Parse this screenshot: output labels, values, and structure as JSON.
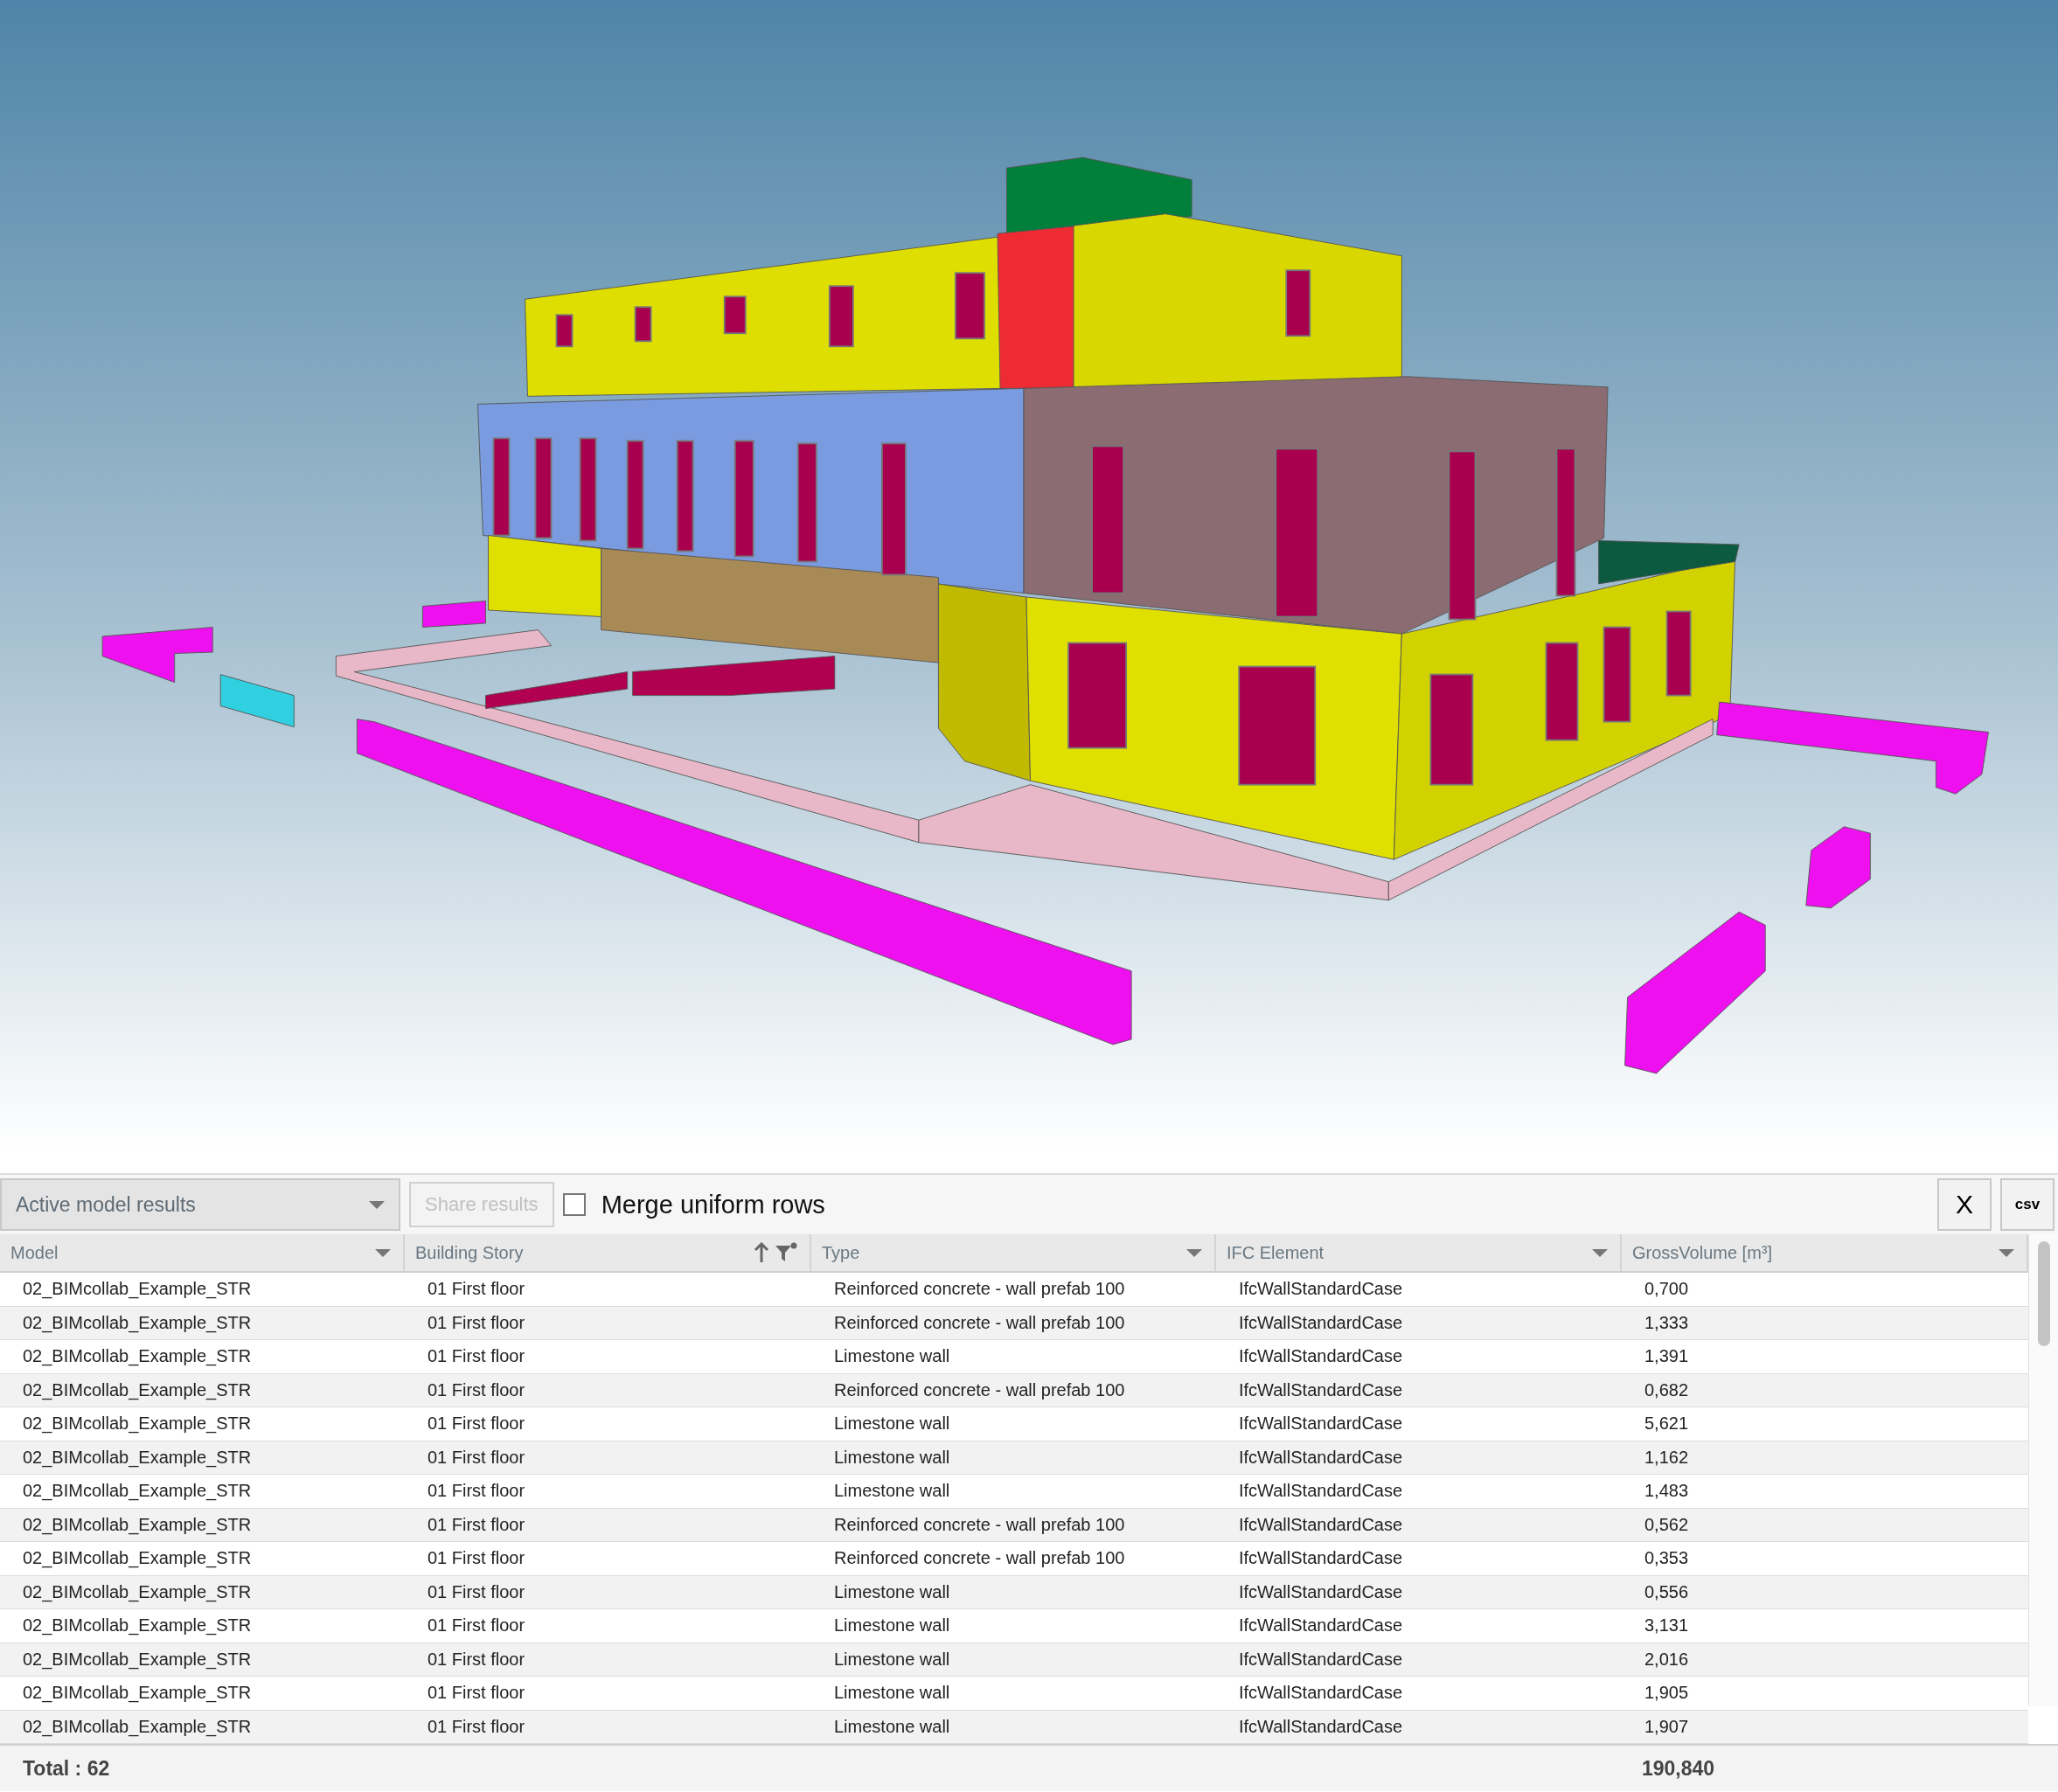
{
  "toolbar": {
    "results_dropdown": {
      "value": "Active model results"
    },
    "share_button": {
      "label": "Share results",
      "disabled": true
    },
    "merge_checkbox": {
      "label": "Merge uniform rows",
      "checked": false
    },
    "close_button": {
      "label": "X"
    },
    "csv_button": {
      "label": "csv"
    }
  },
  "table": {
    "columns": [
      {
        "label": "Model",
        "sorted": false,
        "filtered": false
      },
      {
        "label": "Building Story",
        "sorted": true,
        "filtered": true
      },
      {
        "label": "Type",
        "sorted": false,
        "filtered": false
      },
      {
        "label": "IFC Element",
        "sorted": false,
        "filtered": false
      },
      {
        "label": "GrossVolume [m³]",
        "sorted": false,
        "filtered": false
      }
    ],
    "rows": [
      [
        "02_BIMcollab_Example_STR",
        "01 First floor",
        "Reinforced concrete - wall prefab 100",
        "IfcWallStandardCase",
        "0,700"
      ],
      [
        "02_BIMcollab_Example_STR",
        "01 First floor",
        "Reinforced concrete - wall prefab 100",
        "IfcWallStandardCase",
        "1,333"
      ],
      [
        "02_BIMcollab_Example_STR",
        "01 First floor",
        "Limestone wall",
        "IfcWallStandardCase",
        "1,391"
      ],
      [
        "02_BIMcollab_Example_STR",
        "01 First floor",
        "Reinforced concrete - wall prefab 100",
        "IfcWallStandardCase",
        "0,682"
      ],
      [
        "02_BIMcollab_Example_STR",
        "01 First floor",
        "Limestone wall",
        "IfcWallStandardCase",
        "5,621"
      ],
      [
        "02_BIMcollab_Example_STR",
        "01 First floor",
        "Limestone wall",
        "IfcWallStandardCase",
        "1,162"
      ],
      [
        "02_BIMcollab_Example_STR",
        "01 First floor",
        "Limestone wall",
        "IfcWallStandardCase",
        "1,483"
      ],
      [
        "02_BIMcollab_Example_STR",
        "01 First floor",
        "Reinforced concrete - wall prefab 100",
        "IfcWallStandardCase",
        "0,562"
      ],
      [
        "02_BIMcollab_Example_STR",
        "01 First floor",
        "Reinforced concrete - wall prefab 100",
        "IfcWallStandardCase",
        "0,353"
      ],
      [
        "02_BIMcollab_Example_STR",
        "01 First floor",
        "Limestone wall",
        "IfcWallStandardCase",
        "0,556"
      ],
      [
        "02_BIMcollab_Example_STR",
        "01 First floor",
        "Limestone wall",
        "IfcWallStandardCase",
        "3,131"
      ],
      [
        "02_BIMcollab_Example_STR",
        "01 First floor",
        "Limestone wall",
        "IfcWallStandardCase",
        "2,016"
      ],
      [
        "02_BIMcollab_Example_STR",
        "01 First floor",
        "Limestone wall",
        "IfcWallStandardCase",
        "1,905"
      ],
      [
        "02_BIMcollab_Example_STR",
        "01 First floor",
        "Limestone wall",
        "IfcWallStandardCase",
        "1,907"
      ]
    ],
    "footer": {
      "count": "Total : 62",
      "total": "190,840"
    }
  }
}
